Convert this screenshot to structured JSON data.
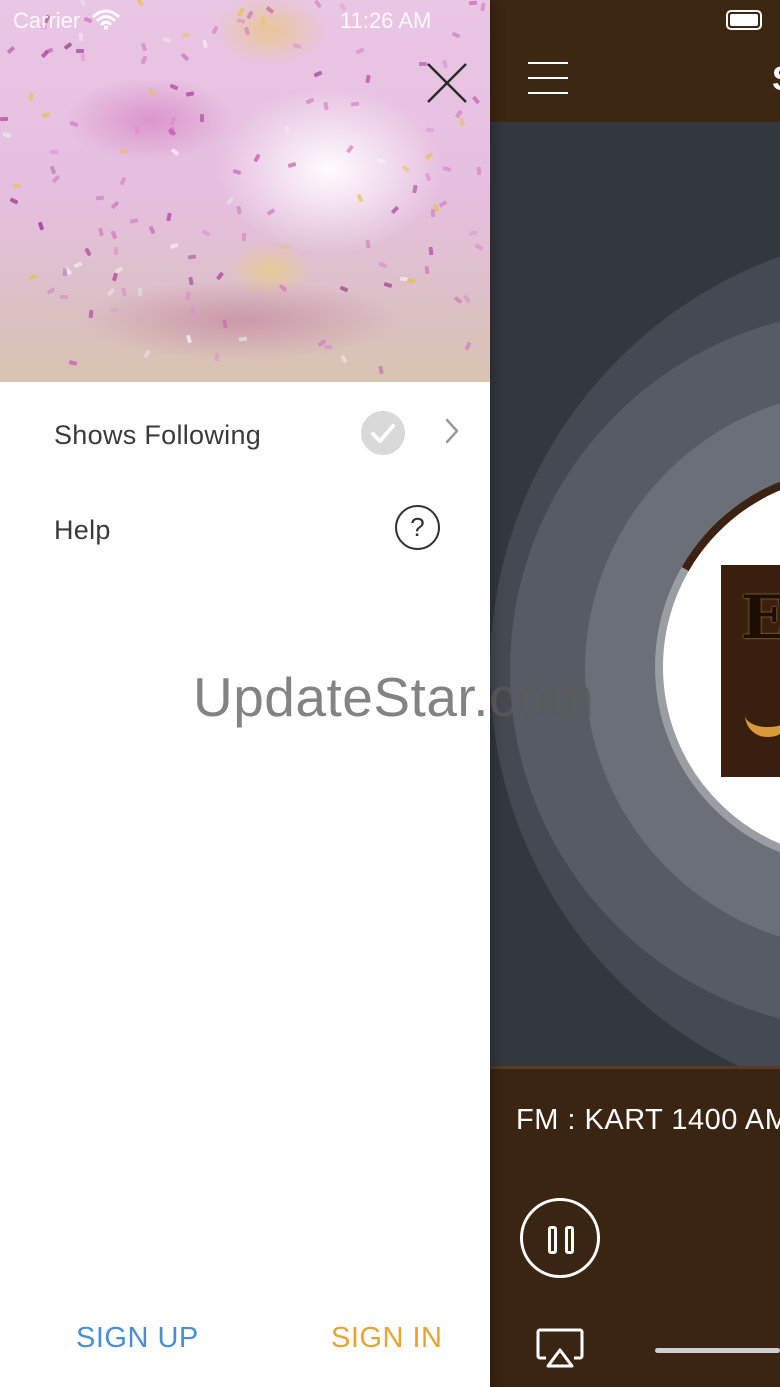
{
  "status_bar": {
    "carrier": "Carrier",
    "time": "11:26 AM"
  },
  "drawer": {
    "menu": [
      {
        "label": "Shows Following"
      },
      {
        "label": "Help",
        "icon_glyph": "?"
      }
    ],
    "sign_up": "SIGN UP",
    "sign_in": "SIGN IN"
  },
  "main": {
    "title_fragment": "S",
    "album_letter": "E",
    "now_playing": "FM : KART 1400 AM"
  },
  "watermark": "UpdateStar.com",
  "colors": {
    "brown": "#3d2612",
    "sign_up_blue": "#4a8fd6",
    "sign_in_orange": "#e8a431",
    "disc_ring": "#9a9ea4"
  }
}
